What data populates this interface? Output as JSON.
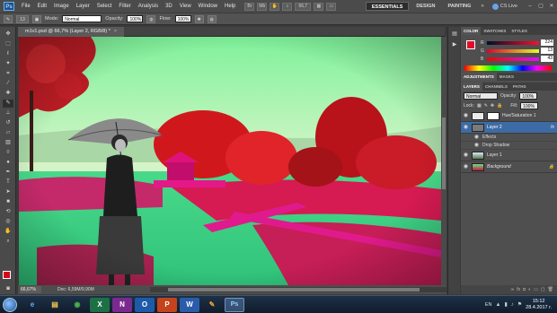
{
  "menubar": {
    "logo": "Ps",
    "items": [
      "File",
      "Edit",
      "Image",
      "Layer",
      "Select",
      "Filter",
      "Analysis",
      "3D",
      "View",
      "Window",
      "Help"
    ],
    "zoom_display": "66,7",
    "workspaces": [
      "ESSENTIALS",
      "DESIGN",
      "PAINTING"
    ],
    "more": "»",
    "cs_live": "CS Live"
  },
  "options": {
    "brush_size": "13",
    "mode_label": "Mode:",
    "mode_value": "Normal",
    "opacity_label": "Opacity:",
    "opacity_value": "100%",
    "flow_label": "Flow:",
    "flow_value": "100%"
  },
  "document": {
    "tab_title": "m1v1.psd @ 66,7% (Layer 2, RGB/8) *",
    "zoom": "66,67%",
    "doc_info": "Doc: 6,59M/9,90M"
  },
  "color_panel": {
    "tabs": [
      "COLOR",
      "SWATCHES",
      "STYLES"
    ],
    "r_label": "R",
    "r_value": "224",
    "g_label": "G",
    "g_value": "13",
    "b_label": "B",
    "b_value": "43",
    "fg_color": "#e00d2b"
  },
  "adjustments_panel": {
    "tabs": [
      "ADJUSTMENTS",
      "MASKS"
    ]
  },
  "layers_panel": {
    "tabs": [
      "LAYERS",
      "CHANNELS",
      "PATHS"
    ],
    "blend_mode": "Normal",
    "opacity_label": "Opacity:",
    "opacity_value": "100%",
    "lock_label": "Lock:",
    "fill_label": "Fill:",
    "fill_value": "100%",
    "layers": [
      {
        "name": "Hue/Saturation 1"
      },
      {
        "name": "Layer 2",
        "fx": "fx"
      },
      {
        "name": "Effects"
      },
      {
        "name": "Drop Shadow"
      },
      {
        "name": "Layer 1"
      },
      {
        "name": "Background"
      }
    ]
  },
  "taskbar": {
    "apps": [
      "IE",
      "Explorer",
      "Chrome",
      "Excel",
      "OneNote",
      "Outlook",
      "PowerPoint",
      "Word",
      "Paint",
      "Photoshop"
    ],
    "app_glyphs": [
      "e",
      "▤",
      "◉",
      "X",
      "N",
      "O",
      "P",
      "W",
      "✎",
      "Ps"
    ],
    "language": "EN",
    "time": "15:12",
    "date": "28.4.2017 г."
  }
}
